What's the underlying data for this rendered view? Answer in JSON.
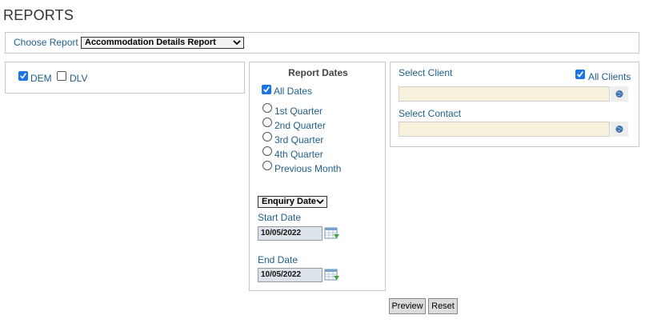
{
  "page": {
    "title": "REPORTS"
  },
  "choose_report": {
    "label": "Choose Report",
    "selected": "Accommodation Details Report"
  },
  "sites": [
    {
      "label": "DEM",
      "checked": true
    },
    {
      "label": "DLV",
      "checked": false
    }
  ],
  "report_dates": {
    "title": "Report Dates",
    "all_dates_label": "All Dates",
    "all_dates_checked": true,
    "options": [
      "1st Quarter",
      "2nd Quarter",
      "3rd Quarter",
      "4th Quarter",
      "Previous Month"
    ],
    "date_type_selected": "Enquiry Date",
    "start_date_label": "Start Date",
    "start_date_value": "10/05/2022",
    "end_date_label": "End Date",
    "end_date_value": "10/05/2022"
  },
  "client": {
    "select_client_label": "Select Client",
    "all_clients_label": "All Clients",
    "all_clients_checked": true,
    "client_value": "",
    "select_contact_label": "Select Contact",
    "contact_value": ""
  },
  "buttons": {
    "preview": "Preview",
    "reset": "Reset"
  },
  "colors": {
    "label": "#1f5f8b",
    "input_bg": "#f7f1dc",
    "checkbox_accent": "#1a73e8"
  }
}
